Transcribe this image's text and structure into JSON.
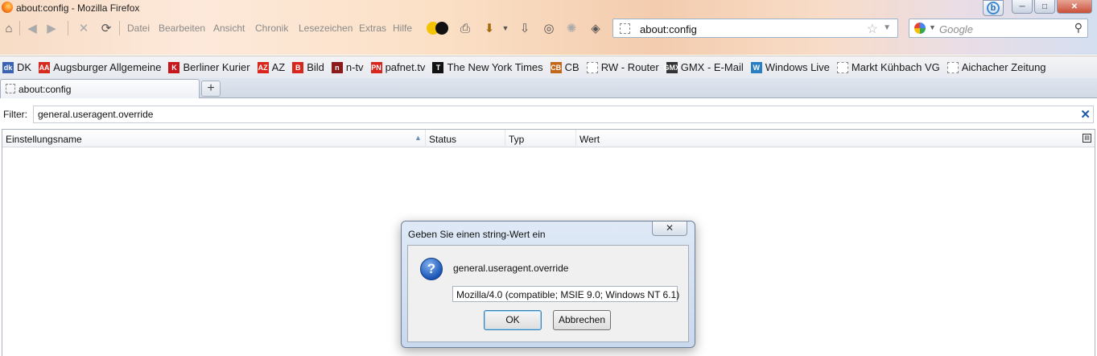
{
  "window": {
    "title": "about:config - Mozilla Firefox",
    "controls": [
      "minimize",
      "maximize",
      "close"
    ]
  },
  "menu": {
    "items": [
      "Datei",
      "Bearbeiten",
      "Ansicht",
      "Chronik",
      "Lesezeichen",
      "Extras",
      "Hilfe"
    ]
  },
  "toolbar": {
    "icons": [
      "home-icon",
      "back-icon",
      "forward-icon",
      "stop-icon",
      "reload-icon",
      "theme-toggle-icon",
      "print-icon",
      "download-icon",
      "download-arrow-icon",
      "history-icon",
      "loading-icon",
      "addon-icon"
    ]
  },
  "urlbar": {
    "value": "about:config"
  },
  "search": {
    "placeholder": "Google"
  },
  "bookmarks": [
    {
      "label": "DK",
      "icon": "dk",
      "color": "#3b63b4"
    },
    {
      "label": "Augsburger Allgemeine",
      "icon": "AA",
      "color": "#d42a1f"
    },
    {
      "label": "Berliner Kurier",
      "icon": "K",
      "color": "#c8161d"
    },
    {
      "label": "AZ",
      "icon": "AZ",
      "color": "#d8261c"
    },
    {
      "label": "Bild",
      "icon": "B",
      "color": "#d8261c"
    },
    {
      "label": "n-tv",
      "icon": "n",
      "color": "#8b1a1a"
    },
    {
      "label": "pafnet.tv",
      "icon": "PN",
      "color": "#d8261c"
    },
    {
      "label": "The New York Times",
      "icon": "T",
      "color": "#111111"
    },
    {
      "label": "CB",
      "icon": "CB",
      "color": "#c2671c"
    },
    {
      "label": "RW - Router",
      "icon": "",
      "color": "#ffffff"
    },
    {
      "label": "GMX - E-Mail",
      "icon": "GMX",
      "color": "#333333"
    },
    {
      "label": "Windows Live",
      "icon": "W",
      "color": "#2a7ec4"
    },
    {
      "label": "Markt Kühbach VG",
      "icon": "",
      "color": "#ffffff"
    },
    {
      "label": "Aichacher Zeitung",
      "icon": "",
      "color": "#ffffff"
    }
  ],
  "tabs": [
    {
      "label": "about:config"
    }
  ],
  "new_tab_label": "+",
  "filter": {
    "label": "Filter:",
    "value": "general.useragent.override"
  },
  "table": {
    "columns": [
      "Einstellungsname",
      "Status",
      "Typ",
      "Wert"
    ]
  },
  "dialog": {
    "title": "Geben Sie einen string-Wert ein",
    "close_glyph": "✕",
    "pref_name": "general.useragent.override",
    "input_value": "Mozilla/4.0 (compatible; MSIE 9.0; Windows NT 6.1)",
    "ok_label": "OK",
    "cancel_label": "Abbrechen"
  }
}
